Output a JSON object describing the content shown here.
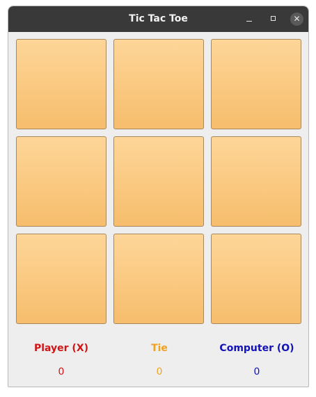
{
  "window": {
    "title": "Tic Tac Toe",
    "controls": [
      "minimize-icon",
      "maximize-icon",
      "close-icon"
    ]
  },
  "board": {
    "cells": [
      "",
      "",
      "",
      "",
      "",
      "",
      "",
      "",
      ""
    ]
  },
  "scores": {
    "player": {
      "label": "Player (X)",
      "value": "0",
      "color": "#d01515"
    },
    "tie": {
      "label": "Tie",
      "value": "0",
      "color": "#f0a21e"
    },
    "computer": {
      "label": "Computer (O)",
      "value": "0",
      "color": "#1212b8"
    }
  }
}
